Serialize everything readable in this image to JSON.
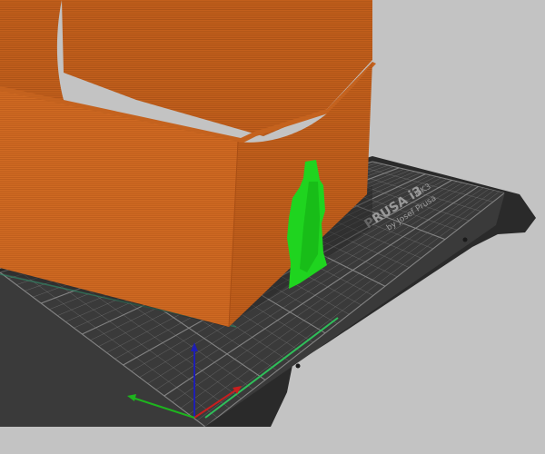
{
  "viewport": {
    "background": "#c3c3c3"
  },
  "bed": {
    "logo_main": "PRUSA i3",
    "logo_model": "MK3",
    "logo_by": "by Josef Prusa",
    "plate_color": "#2e2e2e",
    "grid_color": "#8c8c8c"
  },
  "model": {
    "color": "#d2691e",
    "support_color": "#1ed41e"
  },
  "axes": {
    "x_color": "#c81e1e",
    "y_color": "#1eb41e",
    "z_color": "#1e1eb4"
  }
}
